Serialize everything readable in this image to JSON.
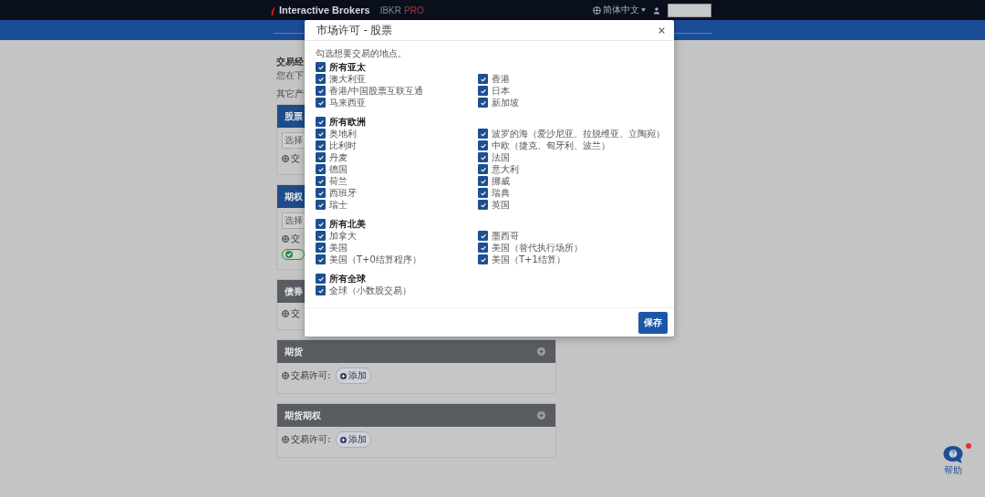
{
  "header": {
    "logo_text": "Interactive Brokers",
    "product_name": "IBKR",
    "product_tier": "PRO",
    "language": "简体中文"
  },
  "page": {
    "heading": "交易经",
    "description": "您在下",
    "section_label": "其它产"
  },
  "cards": [
    {
      "title": "股票",
      "kind": "primary",
      "select_button": "选择",
      "permission": "交"
    },
    {
      "title": "期权",
      "kind": "primary",
      "select_button": "选择",
      "permission": "交",
      "status_chip": true
    },
    {
      "title": "债券",
      "kind": "secondary",
      "permission": "交"
    },
    {
      "title": "期货",
      "kind": "secondary",
      "permission": "交易许可:",
      "add_chip": "添加",
      "expand_icon": true
    },
    {
      "title": "期货期权",
      "kind": "secondary",
      "permission": "交易许可:",
      "add_chip": "添加",
      "expand_icon": true
    }
  ],
  "modal": {
    "title": "市场许可 - 股票",
    "instruction": "勾选想要交易的地点。",
    "save_button": "保存",
    "groups": [
      {
        "label": "所有亚太",
        "checked": true,
        "items": [
          {
            "label": "澳大利亚",
            "checked": true
          },
          {
            "label": "香港",
            "checked": true
          },
          {
            "label": "香港/中国股票互联互通",
            "checked": true
          },
          {
            "label": "日本",
            "checked": true
          },
          {
            "label": "马来西亚",
            "checked": true
          },
          {
            "label": "新加坡",
            "checked": true
          }
        ]
      },
      {
        "label": "所有欧洲",
        "checked": true,
        "items": [
          {
            "label": "奥地利",
            "checked": true
          },
          {
            "label": "波罗的海（爱沙尼亚、拉脱维亚、立陶宛）",
            "checked": true
          },
          {
            "label": "比利时",
            "checked": true
          },
          {
            "label": "中欧（捷克、匈牙利、波兰）",
            "checked": true
          },
          {
            "label": "丹麦",
            "checked": true
          },
          {
            "label": "法国",
            "checked": true
          },
          {
            "label": "德国",
            "checked": true
          },
          {
            "label": "意大利",
            "checked": true
          },
          {
            "label": "荷兰",
            "checked": true
          },
          {
            "label": "挪威",
            "checked": true
          },
          {
            "label": "西班牙",
            "checked": true
          },
          {
            "label": "瑞典",
            "checked": true
          },
          {
            "label": "瑞士",
            "checked": true
          },
          {
            "label": "英国",
            "checked": true
          }
        ]
      },
      {
        "label": "所有北美",
        "checked": true,
        "items": [
          {
            "label": "加拿大",
            "checked": true
          },
          {
            "label": "墨西哥",
            "checked": true
          },
          {
            "label": "美国",
            "checked": true
          },
          {
            "label": "美国（替代执行场所）",
            "checked": true
          },
          {
            "label": "美国（T+0结算程序）",
            "checked": true
          },
          {
            "label": "美国（T+1结算）",
            "checked": true
          }
        ]
      },
      {
        "label": "所有全球",
        "checked": true,
        "items": [
          {
            "label": "全球（小数股交易）",
            "checked": true
          }
        ]
      }
    ]
  },
  "help": {
    "label": "帮助",
    "notification": true
  }
}
